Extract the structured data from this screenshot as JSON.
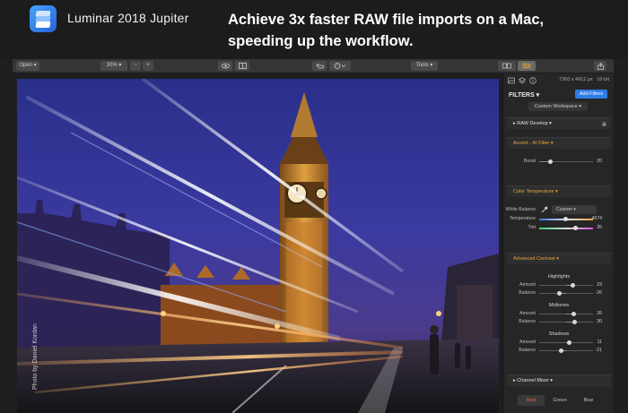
{
  "banner": {
    "app_name": "Luminar 2018 Jupiter",
    "headline_line1": "Achieve 3x faster RAW file imports on a Mac,",
    "headline_line2": "speeding up the workflow."
  },
  "toolbar": {
    "open_label": "Open",
    "zoom_value": "30%",
    "zoom_out_label": "−",
    "zoom_in_label": "+",
    "tools_label": "Tools",
    "icons": [
      "eye-icon",
      "compare-icon",
      "undo-icon",
      "history-icon",
      "filmstrip-icon",
      "sliders-icon",
      "share-icon"
    ]
  },
  "canvas": {
    "photo_credit": "Photo by Daniel Kordan"
  },
  "panel": {
    "dimensions": "7360 x 4912 px",
    "bit_depth": "16-bit",
    "filters_title": "FILTERS",
    "add_filters_label": "Add Filters",
    "workspace_label": "Custom Workspace",
    "raw_develop_title": "RAW Develop",
    "accent": {
      "title": "Accent - AI Filter",
      "boost_label": "Boost",
      "boost_value": "20"
    },
    "color_temp": {
      "title": "Color Temperature",
      "white_balance_label": "White Balance",
      "white_balance_value": "Custom",
      "temperature_label": "Temperature",
      "temperature_value": "4674",
      "tint_label": "Tint",
      "tint_value": "35"
    },
    "advanced_contrast": {
      "title": "Advanced Contrast",
      "highlights_title": "Highlights",
      "highlights_amount_label": "Amount",
      "highlights_amount_value": "23",
      "highlights_balance_label": "Balance",
      "highlights_balance_value": "-26",
      "midtones_title": "Midtones",
      "midtones_amount_label": "Amount",
      "midtones_amount_value": "26",
      "midtones_balance_label": "Balance",
      "midtones_balance_value": "30",
      "shadows_title": "Shadows",
      "shadows_amount_label": "Amount",
      "shadows_amount_value": "11",
      "shadows_balance_label": "Balance",
      "shadows_balance_value": "-21"
    },
    "channel_mixer": {
      "title": "Channel Mixer",
      "tabs": [
        "Red",
        "Green",
        "Blue"
      ]
    }
  },
  "colors": {
    "accent_blue": "#2f7ce6",
    "section_accent": "#e6a43a",
    "active_tab_red": "#ff5c4d"
  }
}
